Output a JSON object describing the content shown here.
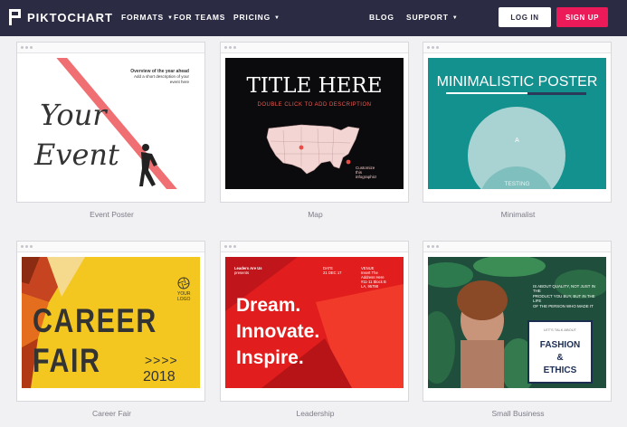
{
  "brand": {
    "name": "PIKTOCHART",
    "accent": "#ed1a5a",
    "nav_bg": "#2b2c43"
  },
  "nav": {
    "formats": "FORMATS",
    "for_teams": "FOR TEAMS",
    "pricing": "PRICING",
    "blog": "BLOG",
    "support": "SUPPORT",
    "login": "LOG IN",
    "signup": "SIGN UP"
  },
  "templates": [
    {
      "label": "Event Poster"
    },
    {
      "label": "Map"
    },
    {
      "label": "Minimalist"
    },
    {
      "label": "Career Fair"
    },
    {
      "label": "Leadership"
    },
    {
      "label": "Small Business"
    }
  ],
  "event_poster": {
    "heading": "Overview of the year ahead",
    "sub1": "Add a short description of your",
    "sub2": "event here",
    "word1": "Your",
    "word2": "Event"
  },
  "map": {
    "title": "TITLE HERE",
    "desc": "DOUBLE CLICK TO ADD DESCRIPTION",
    "cap1": "Customize",
    "cap2": "this",
    "cap3": "infographic!"
  },
  "minimal": {
    "title": "MINIMALISTIC POSTER",
    "a": "A",
    "testing": "TESTING"
  },
  "career": {
    "logo1": "YOUR",
    "logo2": "LOGO",
    "line1": "CAREER",
    "line2": "FAIR",
    "arrows": ">>>>",
    "year": "2018"
  },
  "leadership": {
    "org1": "Leaders Are Us",
    "org2": "presents",
    "date_head": "DATE",
    "date": "21 DEC 17",
    "venue_head": "VENUE",
    "venue1": "Insert The",
    "venue2": "Address Here",
    "venue3": "#11-11 Block B",
    "venue4": "LA, 95798",
    "w1": "Dream.",
    "w2": "Innovate.",
    "w3": "Inspire."
  },
  "small_business": {
    "text1": "IS ABOUT QUALITY, NOT JUST IN THE",
    "text2": "PRODUCT YOU BUY, BUT IN THE LIFE",
    "text3": "OF THE PERSON WHO MADE IT",
    "box_top": "LET'S TALK ABOUT",
    "f1": "FASHION",
    "f2": "&",
    "f3": "ETHICS"
  }
}
